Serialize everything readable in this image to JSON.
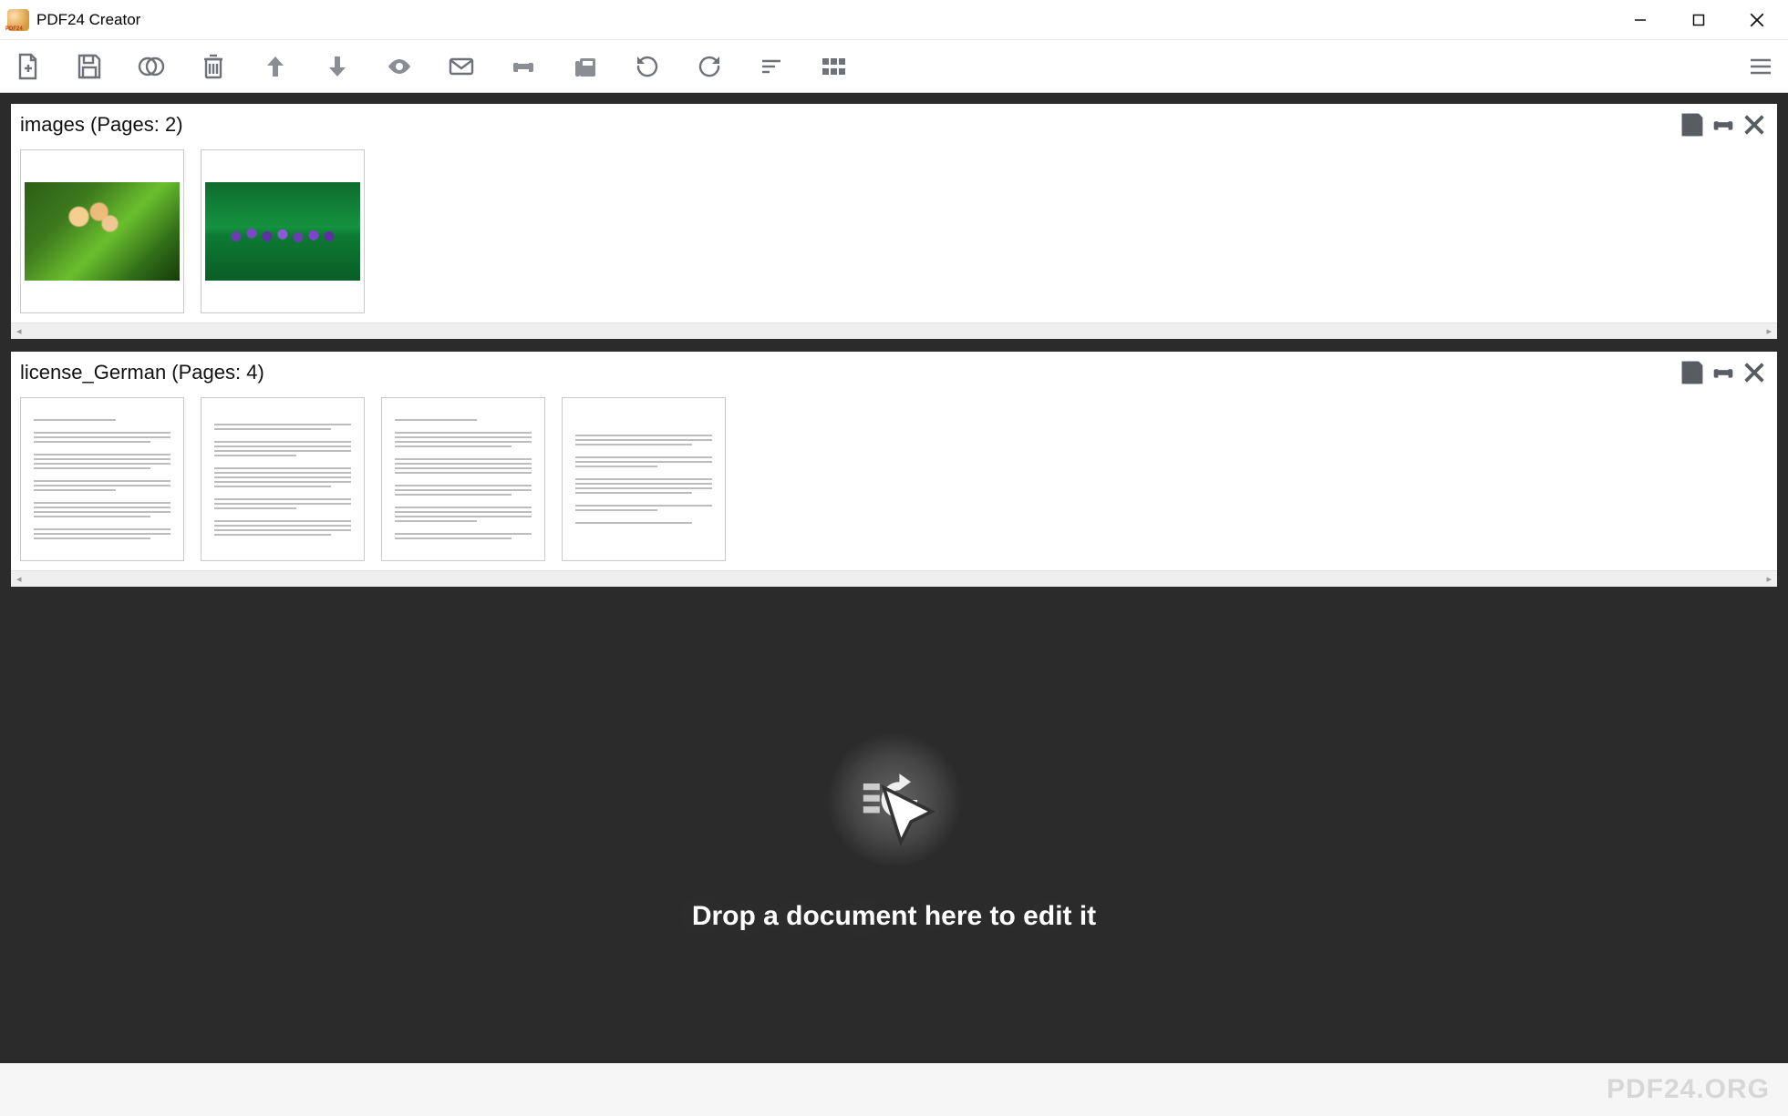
{
  "window": {
    "title": "PDF24 Creator"
  },
  "toolbar": {
    "buttons": [
      "new-file",
      "save",
      "merge",
      "delete",
      "move-up",
      "move-down",
      "preview",
      "email",
      "print",
      "fax",
      "rotate-left",
      "rotate-right",
      "sort",
      "grid-view"
    ]
  },
  "documents": [
    {
      "name": "images",
      "page_count": 2,
      "title_text": "images (Pages: 2)",
      "thumbnails": [
        {
          "kind": "image",
          "desc": "flower-branch-photo"
        },
        {
          "kind": "image",
          "desc": "purple-flowers-field-photo"
        }
      ]
    },
    {
      "name": "license_German",
      "page_count": 4,
      "title_text": "license_German (Pages: 4)",
      "thumbnails": [
        {
          "kind": "text-page",
          "desc": "page-1"
        },
        {
          "kind": "text-page",
          "desc": "page-2"
        },
        {
          "kind": "text-page",
          "desc": "page-3"
        },
        {
          "kind": "text-page",
          "desc": "page-4"
        }
      ]
    }
  ],
  "dropzone": {
    "text": "Drop a document here to edit it"
  },
  "footer": {
    "brand": "PDF24.ORG"
  }
}
